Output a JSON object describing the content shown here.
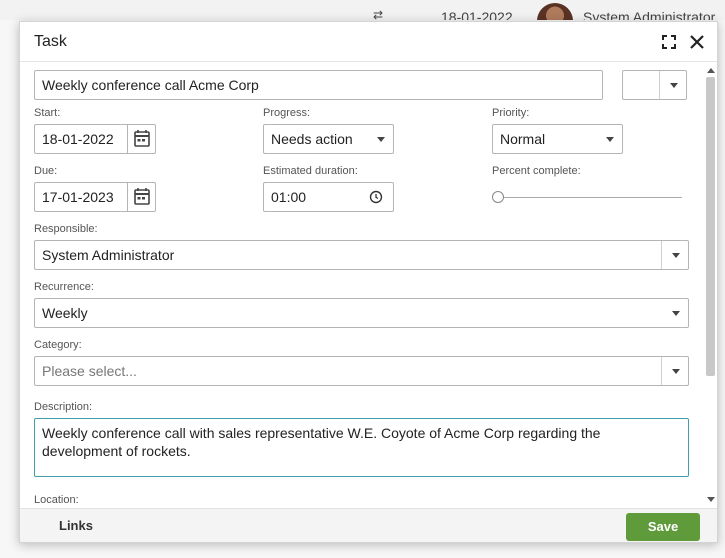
{
  "background": {
    "date": "18-01-2022",
    "user": "System Administrator",
    "icon": "sync-icon"
  },
  "dialog": {
    "title": "Task",
    "maximize_icon": "maximize-icon",
    "close_icon": "close-icon"
  },
  "form": {
    "subject": "Weekly conference call Acme Corp",
    "start_label": "Start:",
    "start_value": "18-01-2022",
    "progress_label": "Progress:",
    "progress_value": "Needs action",
    "priority_label": "Priority:",
    "priority_value": "Normal",
    "due_label": "Due:",
    "due_value": "17-01-2023",
    "est_label": "Estimated duration:",
    "est_value": "01:00",
    "percent_label": "Percent complete:",
    "percent_value": 0,
    "responsible_label": "Responsible:",
    "responsible_value": "System Administrator",
    "recurrence_label": "Recurrence:",
    "recurrence_value": "Weekly",
    "category_label": "Category:",
    "category_placeholder": "Please select...",
    "description_label": "Description:",
    "description_value": "Weekly conference call with sales representative W.E. Coyote of Acme Corp regarding the development of rockets.",
    "location_label": "Location:"
  },
  "footer": {
    "links_label": "Links",
    "save_label": "Save"
  },
  "colors": {
    "save_button": "#5f9b3b",
    "focus_border": "#3f9eaa"
  }
}
